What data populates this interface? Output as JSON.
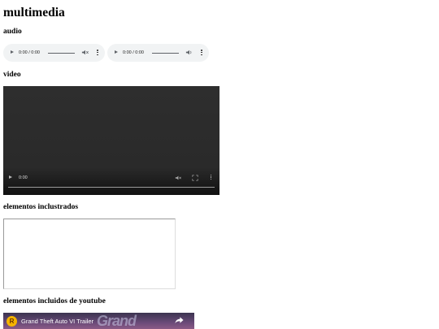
{
  "page": {
    "title": "multimedia"
  },
  "sections": {
    "audio": {
      "heading": "audio"
    },
    "video": {
      "heading": "video"
    },
    "embedded": {
      "heading": "elementos inclustrados"
    },
    "youtube": {
      "heading": "elementos incluidos de youtube"
    }
  },
  "audio_players": [
    {
      "time": "0:00 / 0:00",
      "icons": [
        "play-icon",
        "volume-muted-icon",
        "more-vert-icon"
      ]
    },
    {
      "time": "0:00 / 0:00",
      "icons": [
        "play-icon",
        "volume-icon",
        "more-vert-icon"
      ]
    }
  ],
  "video_player": {
    "time": "0:00",
    "icons": [
      "play-icon",
      "volume-muted-icon",
      "fullscreen-icon",
      "more-vert-icon"
    ]
  },
  "youtube_embed": {
    "channel_logo": "R",
    "video_title": "Grand Theft Auto VI Trailer",
    "watermark": "Grand",
    "icons": [
      "share-icon"
    ],
    "colors": {
      "logo_bg": "#f5b400"
    }
  }
}
